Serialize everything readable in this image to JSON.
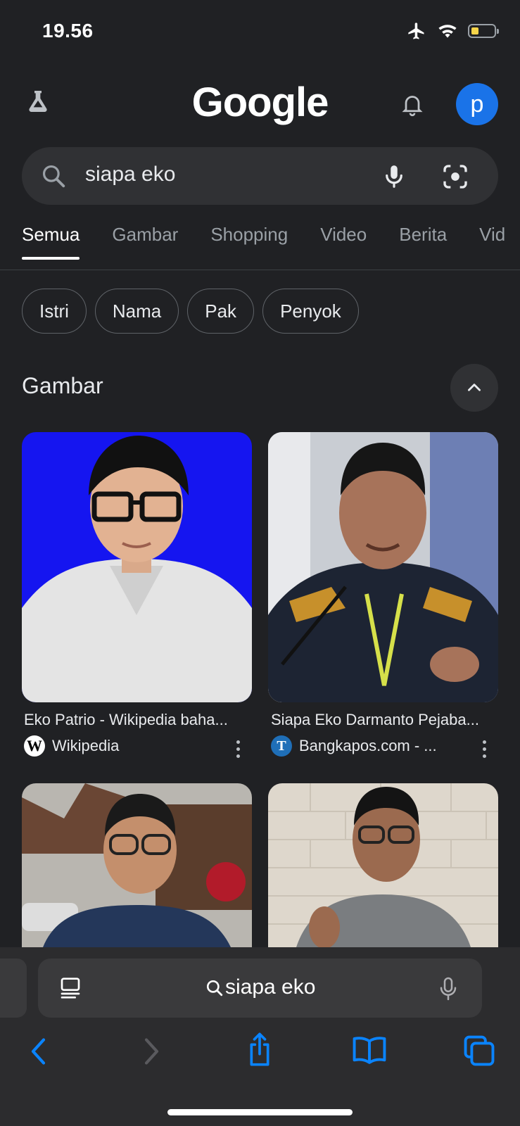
{
  "status": {
    "time": "19.56"
  },
  "header": {
    "logo_text": "Google",
    "avatar_letter": "p"
  },
  "search": {
    "query": "siapa eko"
  },
  "tabs": [
    {
      "label": "Semua",
      "active": true
    },
    {
      "label": "Gambar"
    },
    {
      "label": "Shopping"
    },
    {
      "label": "Video"
    },
    {
      "label": "Berita"
    },
    {
      "label": "Vid"
    }
  ],
  "chips": [
    "Istri",
    "Nama",
    "Pak",
    "Penyok"
  ],
  "images_section": {
    "title": "Gambar",
    "results": [
      {
        "title": "Eko Patrio - Wikipedia baha...",
        "source": "Wikipedia",
        "source_icon": "wikipedia-icon"
      },
      {
        "title": "Siapa Eko Darmanto Pejaba...",
        "source": "Bangkapos.com - ...",
        "source_icon": "bangkapos-icon"
      },
      {
        "title": "",
        "source": ""
      },
      {
        "title": "",
        "source": ""
      }
    ]
  },
  "safari": {
    "address_text": "siapa eko"
  },
  "colors": {
    "background": "#202124",
    "accent_blue": "#1a73e8",
    "safari_bar": "#2c2c2e",
    "ios_blue": "#0a84ff"
  }
}
